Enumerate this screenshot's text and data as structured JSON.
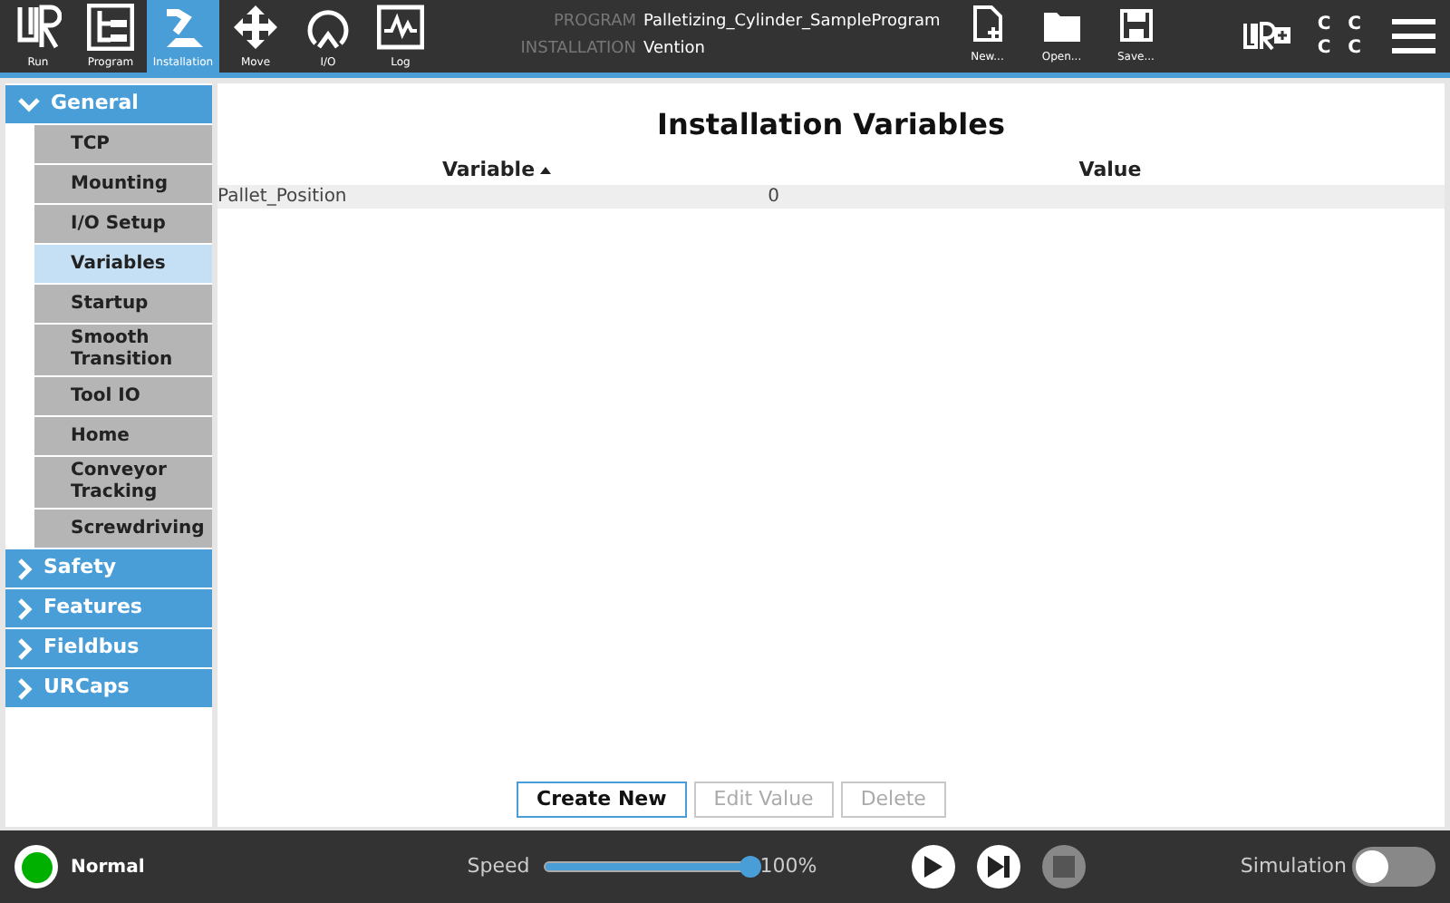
{
  "top_bar": {
    "tabs": [
      {
        "kind": "run",
        "label": "Run",
        "selected": false
      },
      {
        "kind": "program",
        "label": "Program",
        "selected": false
      },
      {
        "kind": "installation",
        "label": "Installation",
        "selected": true
      },
      {
        "kind": "move",
        "label": "Move",
        "selected": false
      },
      {
        "kind": "io",
        "label": "I/O",
        "selected": false
      },
      {
        "kind": "log",
        "label": "Log",
        "selected": false
      }
    ],
    "program_label": "PROGRAM",
    "program_name": "Palletizing_Cylinder_SampleProgram",
    "installation_label": "INSTALLATION",
    "installation_name": "Vention",
    "file_buttons": [
      {
        "kind": "new",
        "label": "New..."
      },
      {
        "kind": "open",
        "label": "Open..."
      },
      {
        "kind": "save",
        "label": "Save..."
      }
    ],
    "indicator_rows": [
      "C C",
      "C C"
    ]
  },
  "sidebar": [
    {
      "label": "General",
      "expanded": true,
      "children": [
        {
          "label": "TCP",
          "selected": false
        },
        {
          "label": "Mounting",
          "selected": false
        },
        {
          "label": "I/O Setup",
          "selected": false
        },
        {
          "label": "Variables",
          "selected": true
        },
        {
          "label": "Startup",
          "selected": false
        },
        {
          "label": "Smooth Transition",
          "selected": false
        },
        {
          "label": "Tool IO",
          "selected": false
        },
        {
          "label": "Home",
          "selected": false
        },
        {
          "label": "Conveyor Tracking",
          "selected": false
        },
        {
          "label": "Screwdriving",
          "selected": false
        }
      ]
    },
    {
      "label": "Safety",
      "expanded": false
    },
    {
      "label": "Features",
      "expanded": false
    },
    {
      "label": "Fieldbus",
      "expanded": false
    },
    {
      "label": "URCaps",
      "expanded": false
    }
  ],
  "content": {
    "title": "Installation Variables",
    "table": {
      "columns": [
        {
          "label": "Variable",
          "sorted": true
        },
        {
          "label": "Value",
          "sorted": false
        }
      ],
      "rows": [
        [
          "Pallet_Position",
          "0"
        ]
      ]
    },
    "buttons": [
      {
        "label": "Create New",
        "disabled": false
      },
      {
        "label": "Edit Value",
        "disabled": true
      },
      {
        "label": "Delete",
        "disabled": true
      }
    ]
  },
  "status_bar": {
    "robot_state": {
      "label": "Normal",
      "color": "#00b000"
    },
    "speed_label": "Speed",
    "speed": {
      "level": 1.0
    },
    "speed_reading": "100%",
    "controls": [
      {
        "kind": "play",
        "disabled": false
      },
      {
        "kind": "step",
        "disabled": false
      },
      {
        "kind": "stop",
        "disabled": true
      }
    ],
    "simulation_label": "Simulation",
    "simulation": {
      "on": false
    }
  }
}
